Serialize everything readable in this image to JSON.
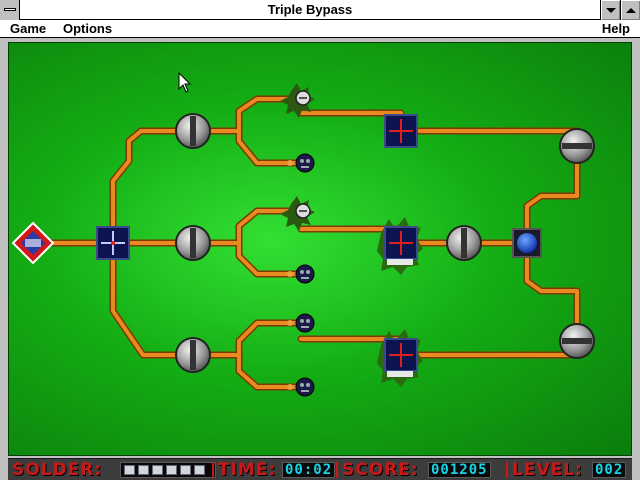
{
  "window": {
    "title": "Triple Bypass"
  },
  "menu": {
    "game": "Game",
    "options": "Options",
    "help": "Help"
  },
  "status": {
    "solder_label": "SOLDER:",
    "solder_cells": 6,
    "time_label": "TIME:",
    "time_value": "00:02",
    "score_label": "SCORE:",
    "score_value": "001205",
    "level_label": "LEVEL:",
    "level_value": "002"
  },
  "colors": {
    "wire": "#e07a10",
    "wire_edge": "#7a3a00",
    "board": "#14ad14",
    "lcd": "#19d4e8",
    "label": "#c81818"
  },
  "icons": [
    "source-diamond-icon",
    "cross-junction-icon",
    "valve-icon",
    "bug-icon",
    "skull-bomb-icon",
    "blue-button-icon",
    "cursor-arrow-icon"
  ]
}
